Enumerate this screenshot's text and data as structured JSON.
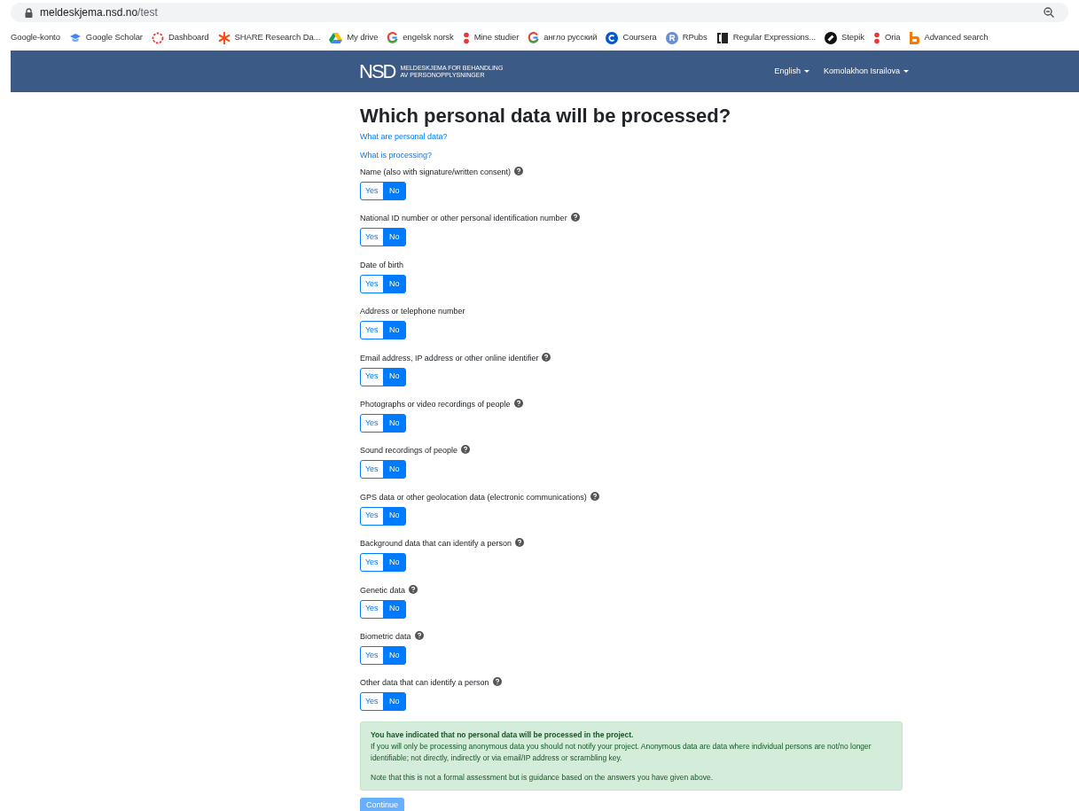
{
  "browser": {
    "url_host": "meldeskjema.nsd.no",
    "url_path": "/test"
  },
  "bookmarks": [
    {
      "label": "Google-konto",
      "kind": "none"
    },
    {
      "label": "Google Scholar",
      "kind": "cap"
    },
    {
      "label": "Dashboard",
      "kind": "ring"
    },
    {
      "label": "SHARE Research Da...",
      "kind": "star"
    },
    {
      "label": "My drive",
      "kind": "drive"
    },
    {
      "label": "engelsk norsk",
      "kind": "g"
    },
    {
      "label": "Mine studier",
      "kind": "dots"
    },
    {
      "label": "англо русский",
      "kind": "g"
    },
    {
      "label": "Coursera",
      "kind": "c"
    },
    {
      "label": "RPubs",
      "kind": "r"
    },
    {
      "label": "Regular Expressions...",
      "kind": "bracket"
    },
    {
      "label": "Stepik",
      "kind": "stepik"
    },
    {
      "label": "Oria",
      "kind": "dots"
    },
    {
      "label": "Advanced search",
      "kind": "b"
    }
  ],
  "header": {
    "logo": "NSD",
    "logo_line_1": "MELDESKJEMA FOR BEHANDLING",
    "logo_line_2": "AV PERSONOPPLYSNINGER",
    "language": "English",
    "user": "Komolakhon Israilova"
  },
  "title": "Which personal data will be processed?",
  "links": [
    "What are personal data?",
    "What is processing?"
  ],
  "questions": [
    {
      "label": "Name (also with signature/written consent)",
      "help": true,
      "options": [
        {
          "label": "Yes",
          "selected": false
        },
        {
          "label": "No",
          "selected": true
        }
      ]
    },
    {
      "label": "National ID number or other personal identification number",
      "help": true,
      "options": [
        {
          "label": "Yes",
          "selected": false
        },
        {
          "label": "No",
          "selected": true
        }
      ]
    },
    {
      "label": "Date of birth",
      "help": false,
      "options": [
        {
          "label": "Yes",
          "selected": false
        },
        {
          "label": "No",
          "selected": true
        }
      ]
    },
    {
      "label": "Address or telephone number",
      "help": false,
      "options": [
        {
          "label": "Yes",
          "selected": false
        },
        {
          "label": "No",
          "selected": true
        }
      ]
    },
    {
      "label": "Email address, IP address or other online identifier",
      "help": true,
      "options": [
        {
          "label": "Yes",
          "selected": false
        },
        {
          "label": "No",
          "selected": true
        }
      ]
    },
    {
      "label": "Photographs or video recordings of people",
      "help": true,
      "options": [
        {
          "label": "Yes",
          "selected": false
        },
        {
          "label": "No",
          "selected": true
        }
      ]
    },
    {
      "label": "Sound recordings of people",
      "help": true,
      "options": [
        {
          "label": "Yes",
          "selected": false
        },
        {
          "label": "No",
          "selected": true
        }
      ]
    },
    {
      "label": "GPS data or other geolocation data (electronic communications)",
      "help": true,
      "options": [
        {
          "label": "Yes",
          "selected": false
        },
        {
          "label": "No",
          "selected": true
        }
      ]
    },
    {
      "label": "Background data that can identify a person",
      "help": true,
      "options": [
        {
          "label": "Yes",
          "selected": false
        },
        {
          "label": "No",
          "selected": true
        }
      ]
    },
    {
      "label": "Genetic data",
      "help": true,
      "options": [
        {
          "label": "Yes",
          "selected": false
        },
        {
          "label": "No",
          "selected": true
        }
      ]
    },
    {
      "label": "Biometric data",
      "help": true,
      "options": [
        {
          "label": "Yes",
          "selected": false
        },
        {
          "label": "No",
          "selected": true
        }
      ]
    },
    {
      "label": "Other data that can identify a person",
      "help": true,
      "options": [
        {
          "label": "Yes",
          "selected": false
        },
        {
          "label": "No",
          "selected": true
        }
      ]
    }
  ],
  "alert": {
    "heading": "You have indicated that no personal data will be processed in the project.",
    "body": "If you will only be processing anonymous data you should not notify your project. Anonymous data are data where individual persons are not/no longer identifiable; not directly, indirectly or via email/IP address or scrambling key.",
    "note": "Note that this is not a formal assessment but is guidance based on the answers you have given above."
  },
  "continue_button": {
    "label": "Continue",
    "disabled": true
  }
}
